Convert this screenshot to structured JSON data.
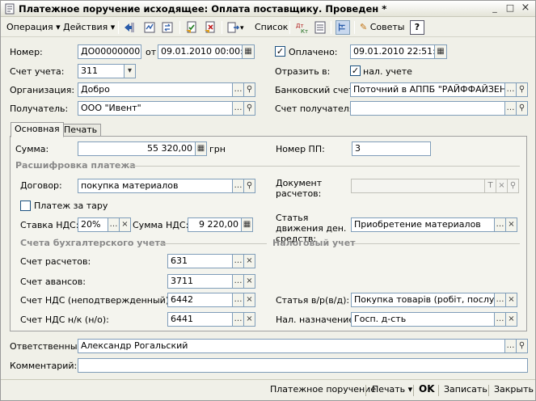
{
  "window": {
    "title": "Платежное поручение исходящее: Оплата поставщику. Проведен *",
    "minimize": "_",
    "maximize": "□",
    "close": "×"
  },
  "toolbar": {
    "operation": "Операция",
    "actions": "Действия",
    "list": "Список",
    "tips": "Советы",
    "help": "?"
  },
  "header": {
    "number_label": "Номер:",
    "number_value": "ДО000000003",
    "from_label": "от",
    "date_value": "09.01.2010 00:00:00",
    "paid_label": "Оплачено:",
    "paid_checked": "✓",
    "paid_date": "09.01.2010 22:51:00",
    "account_label": "Счет учета:",
    "account_value": "311",
    "reflect_label": "Отразить в:",
    "reflect_checked": "✓",
    "reflect_value": "нал. учете",
    "org_label": "Организация:",
    "org_value": "Добро",
    "bank_label": "Банковский счет:",
    "bank_value": "Поточний в АППБ \"РАЙФФАЙЗЕН Е",
    "recipient_label": "Получатель:",
    "recipient_value": "ООО \"Ивент\"",
    "recipient_account_label": "Счет получателя:",
    "recipient_account_value": ""
  },
  "tabs": {
    "main": "Основная",
    "print": "Печать"
  },
  "main": {
    "sum_label": "Сумма:",
    "sum_value": "55 320,00",
    "currency": "грн",
    "pp_number_label": "Номер ПП:",
    "pp_number_value": "3",
    "breakdown_title": "Расшифровка платежа",
    "contract_label": "Договор:",
    "contract_value": "покупка материалов",
    "doc_label": "Документ расчетов:",
    "doc_value": "",
    "container_label": "Платеж за тару",
    "vat_rate_label": "Ставка НДС:",
    "vat_rate_value": "20%",
    "vat_sum_label": "Сумма НДС:",
    "vat_sum_value": "9 220,00",
    "cashflow_label": "Статья движения ден. средств:",
    "cashflow_value": "Приобретение материалов",
    "accounts_title": "Счета бухгалтерского учета",
    "tax_title": "Налоговый учет",
    "settlement_label": "Счет расчетов:",
    "settlement_value": "631",
    "advance_label": "Счет авансов:",
    "advance_value": "3711",
    "vat_unconf_label": "Счет НДС (неподтвержденный):",
    "vat_unconf_value": "6442",
    "vat_nk_label": "Счет НДС н/к (н/о):",
    "vat_nk_value": "6441",
    "article_label": "Статья в/р(в/д):",
    "article_value": "Покупка товарів (робіт, послуг)",
    "purpose_label": "Нал. назначение:",
    "purpose_value": "Госп. д-сть"
  },
  "footer": {
    "responsible_label": "Ответственный:",
    "responsible_value": "Александр Рогальский",
    "comment_label": "Комментарий:",
    "comment_value": ""
  },
  "bottom": {
    "payment_order": "Платежное поручение",
    "print": "Печать",
    "ok": "OK",
    "save": "Записать",
    "close": "Закрыть"
  }
}
